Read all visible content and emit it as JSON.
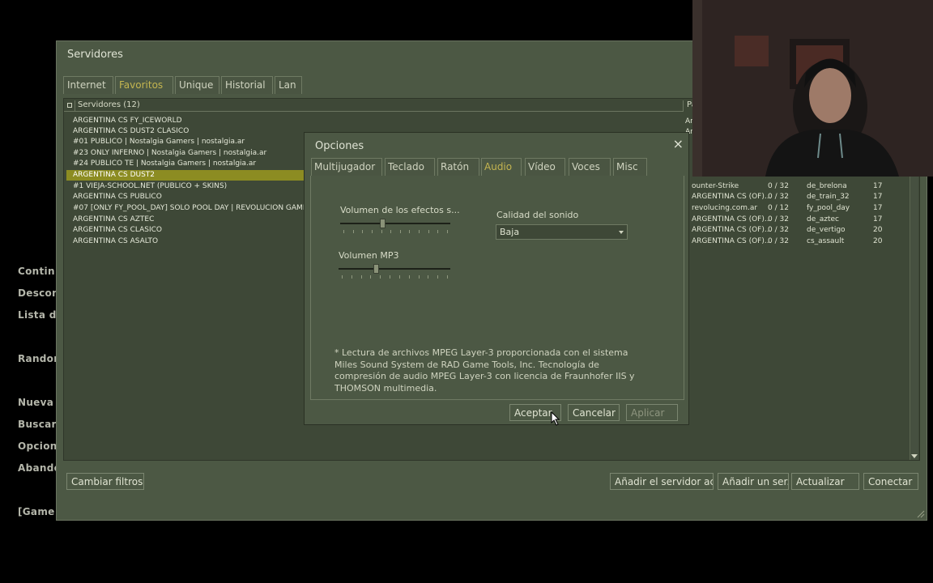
{
  "background_menu": [
    "Contin",
    "Descon",
    "Lista d",
    "Random",
    "Nueva",
    "Buscar",
    "Opcion",
    "Abando",
    "[Game"
  ],
  "servers_window": {
    "title": "Servidores",
    "tabs": [
      "Internet",
      "Favoritos",
      "Unique",
      "Historial",
      "Lan"
    ],
    "active_tab": "Favoritos",
    "list_header": "Servidores (12)",
    "list_header_right": "Pa",
    "server_names": [
      "ARGENTINA CS FY_ICEWORLD",
      "ARGENTINA CS DUST2 CLASICO",
      "#01 PUBLICO | Nostalgia Gamers | nostalgia.ar",
      "#23 ONLY INFERNO | Nostalgia Gamers | nostalgia.ar",
      "#24 PUBLICO TE | Nostalgia Gamers | nostalgia.ar",
      "ARGENTINA CS DUST2",
      "#1 VIEJA-SCHOOL.NET (PUBLICO + SKINS)",
      "ARGENTINA CS PUBLICO",
      "#07 [ONLY FY_POOL_DAY] SOLO POOL DAY | REVOLUCION GAMING",
      "ARGENTINA CS AZTEC",
      "ARGENTINA CS CLASICO",
      "ARGENTINA CS ASALTO"
    ],
    "partial_rows_top": [
      "Ar",
      "Ar"
    ],
    "right_rows": [
      {
        "game": "ounter-Strike",
        "players": "0 / 32",
        "map": "de_brelona",
        "latency": "17"
      },
      {
        "game": "ARGENTINA CS (OF)...",
        "players": "0 / 32",
        "map": "de_train_32",
        "latency": "17"
      },
      {
        "game": "revolucing.com.ar",
        "players": "0 / 12",
        "map": "fy_pool_day",
        "latency": "17"
      },
      {
        "game": "ARGENTINA CS (OF)...",
        "players": "0 / 32",
        "map": "de_aztec",
        "latency": "17"
      },
      {
        "game": "ARGENTINA CS (OF)...",
        "players": "0 / 32",
        "map": "de_vertigo",
        "latency": "20"
      },
      {
        "game": "ARGENTINA CS (OF)...",
        "players": "0 / 32",
        "map": "cs_assault",
        "latency": "20"
      }
    ],
    "buttons": {
      "change_filters": "Cambiar filtros",
      "add_current": "Añadir el servidor act...",
      "add_server": "Añadir un ser...",
      "refresh": "Actualizar",
      "connect": "Conectar"
    }
  },
  "options_dialog": {
    "title": "Opciones",
    "close": "×",
    "tabs": [
      "Multijugador",
      "Teclado",
      "Ratón",
      "Audio",
      "Vídeo",
      "Voces",
      "Misc"
    ],
    "active_tab": "Audio",
    "effects_volume_label": "Volumen de los efectos s...",
    "effects_volume_level": 0.38,
    "mp3_volume_label": "Volumen MP3",
    "mp3_volume_level": 0.33,
    "sound_quality_label": "Calidad del sonido",
    "sound_quality_value": "Baja",
    "footnote": "* Lectura de archivos MPEG Layer-3 proporcionada con el sistema Miles Sound System de RAD Game Tools, Inc. Tecnología de compresión de audio MPEG Layer-3 con licencia de Fraunhofer IIS y THOMSON multimedia.",
    "buttons": {
      "accept": "Aceptar",
      "cancel": "Cancelar",
      "apply": "Aplicar"
    }
  },
  "icons": {
    "lock": "lock-icon",
    "dropdown": "chevron-down-icon",
    "close": "close-icon",
    "resize": "resize-grip-icon",
    "cursor": "mouse-cursor-icon"
  },
  "colors": {
    "accent": "#c4b550",
    "panel": "#4c5844",
    "selection": "#8c8c22"
  }
}
